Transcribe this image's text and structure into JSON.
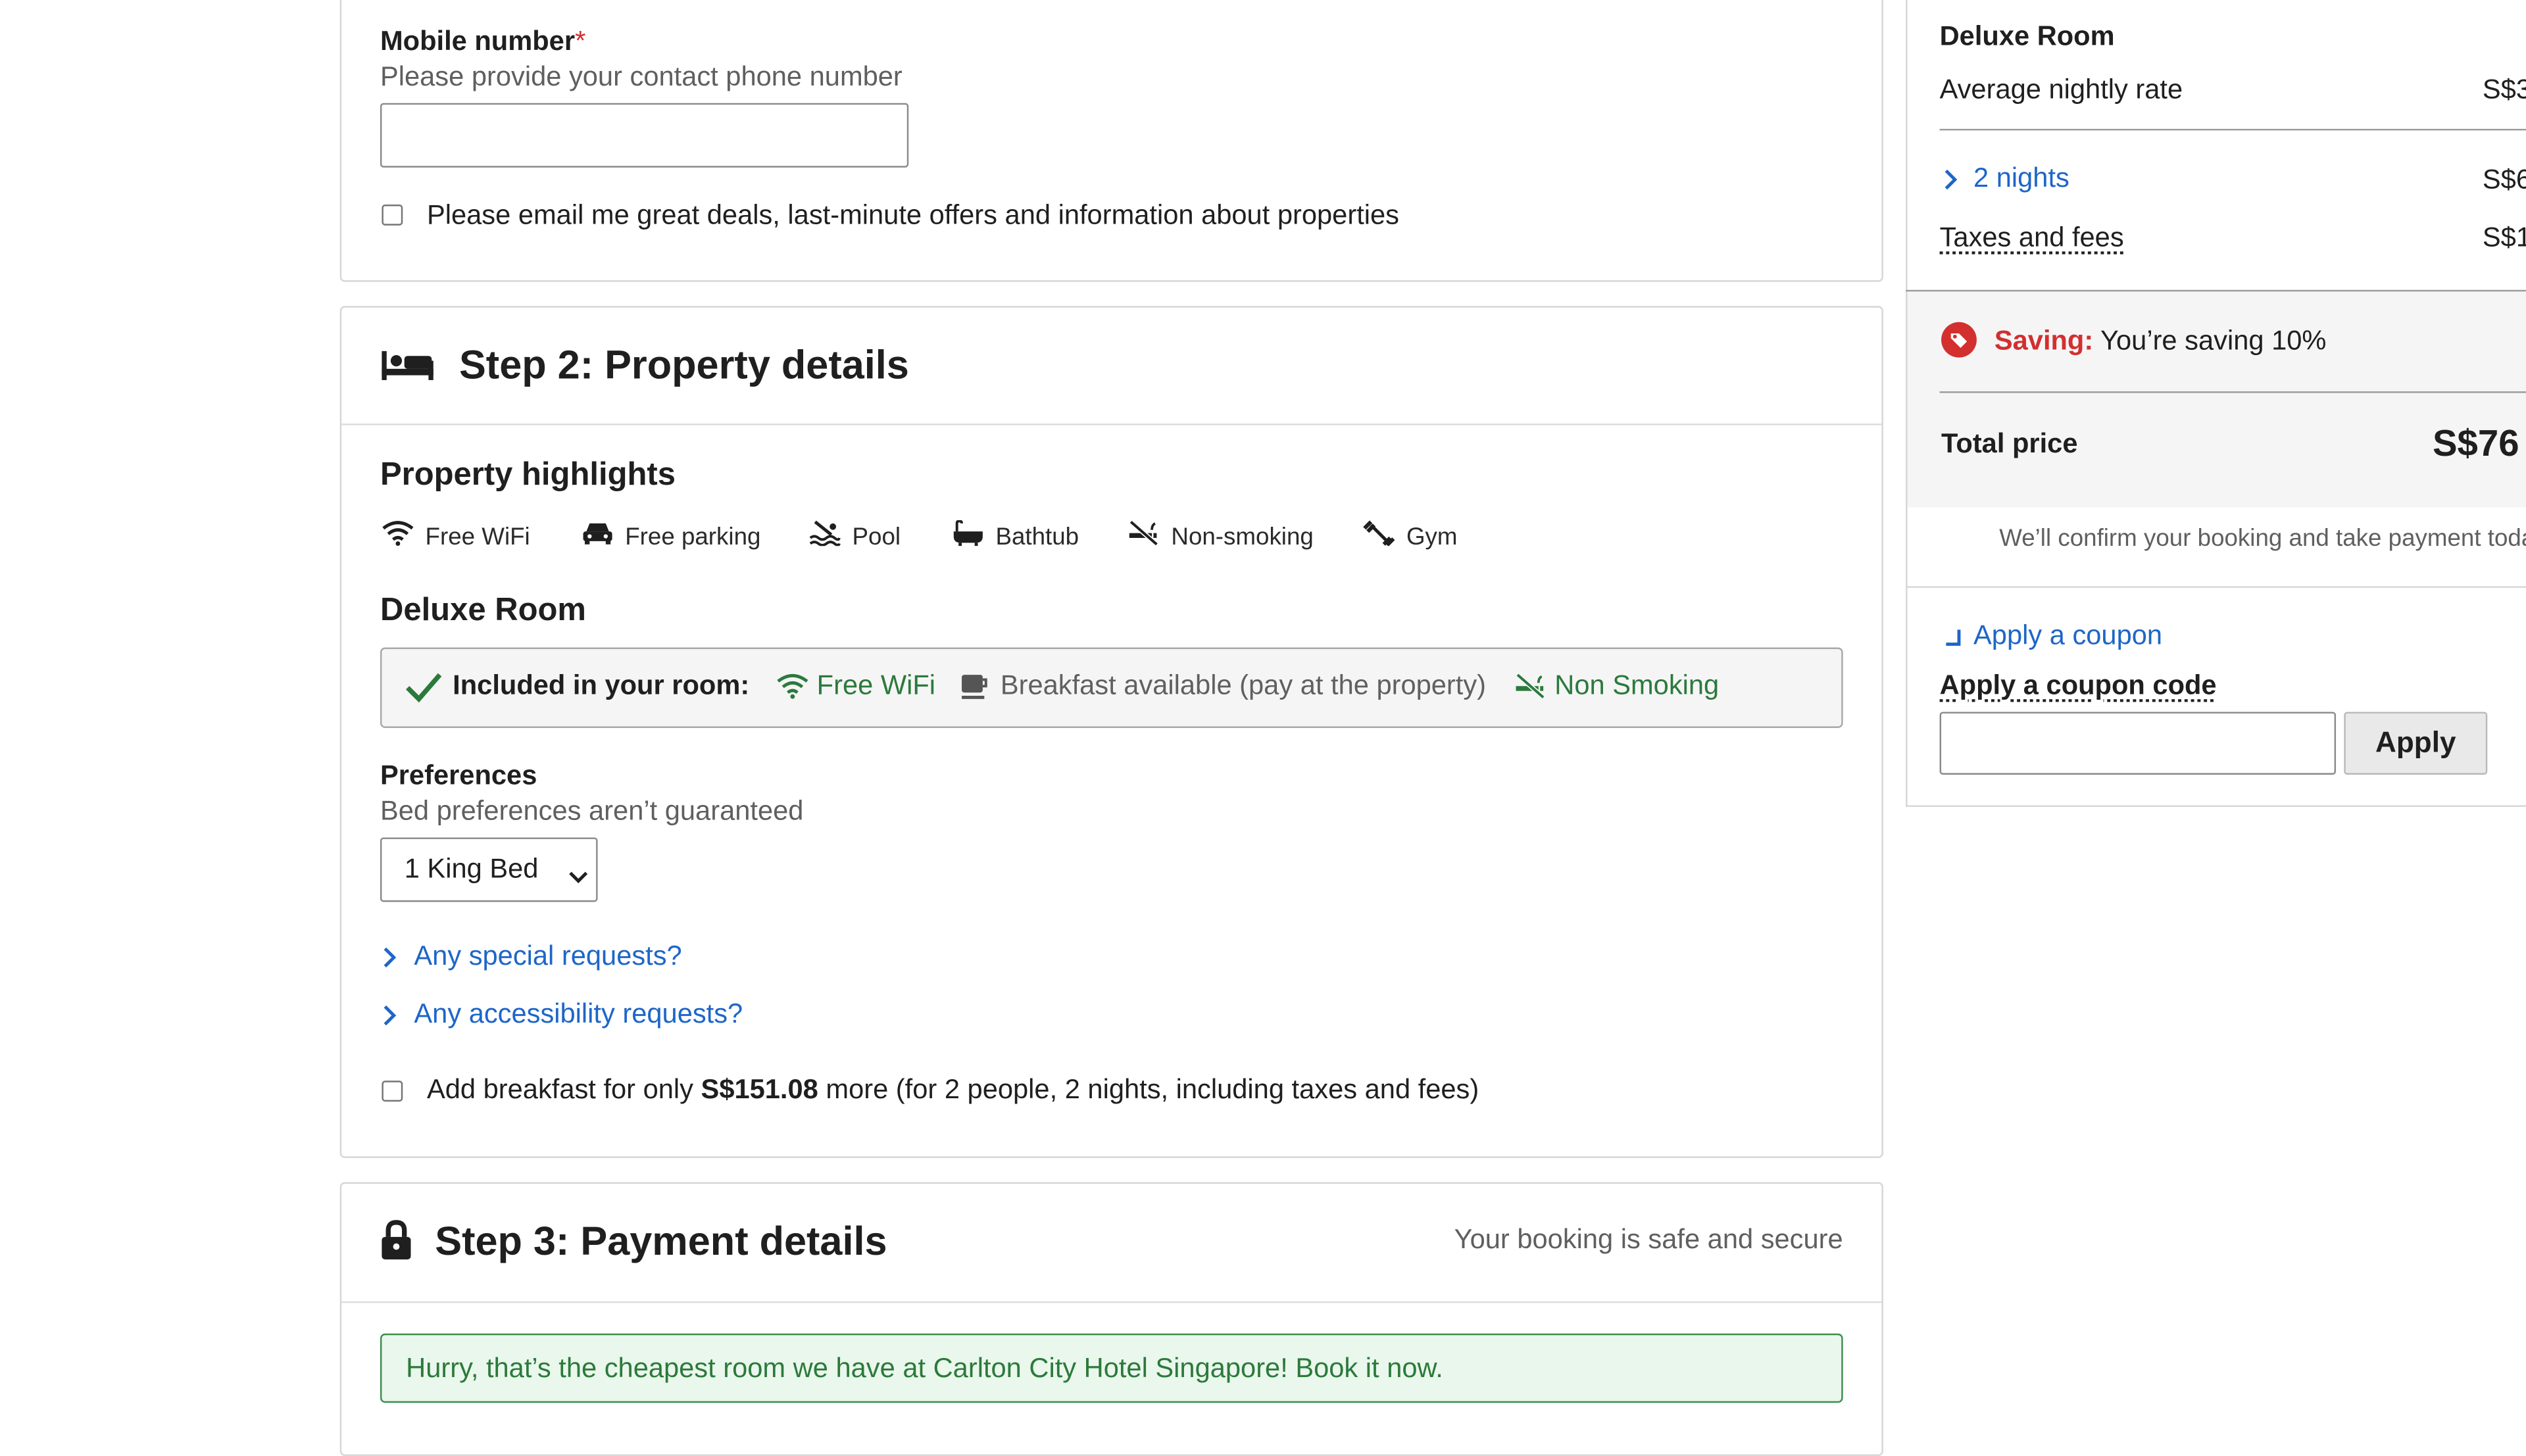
{
  "contact": {
    "mobile_label": "Mobile number",
    "required_mark": "*",
    "mobile_hint": "Please provide your contact phone number",
    "mobile_value": "",
    "email_opt_in_label": "Please email me great deals, last-minute offers and information about properties"
  },
  "step2": {
    "title": "Step 2: Property details",
    "highlights_heading": "Property highlights",
    "highlights": [
      {
        "icon": "wifi-icon",
        "label": "Free WiFi"
      },
      {
        "icon": "car-icon",
        "label": "Free parking"
      },
      {
        "icon": "pool-icon",
        "label": "Pool"
      },
      {
        "icon": "bathtub-icon",
        "label": "Bathtub"
      },
      {
        "icon": "no-smoking-icon",
        "label": "Non-smoking"
      },
      {
        "icon": "gym-icon",
        "label": "Gym"
      }
    ],
    "room_heading": "Deluxe Room",
    "included_label": "Included in your room:",
    "included": [
      {
        "icon": "wifi-icon",
        "label": "Free WiFi"
      },
      {
        "icon": "breakfast-icon",
        "label": "Breakfast available (pay at the property)"
      },
      {
        "icon": "no-smoking-icon",
        "label": "Non Smoking"
      }
    ],
    "preferences_label": "Preferences",
    "preferences_hint": "Bed preferences aren’t guaranteed",
    "bed_selected": "1 King Bed",
    "special_requests_link": "Any special requests?",
    "accessibility_requests_link": "Any accessibility requests?",
    "breakfast_prefix": "Add breakfast for only ",
    "breakfast_price": "S$151.08",
    "breakfast_suffix": " more (for 2 people, 2 nights, including taxes and fees)"
  },
  "step3": {
    "title": "Step 3: Payment details",
    "secure_note": "Your booking is safe and secure",
    "cheapest_banner": "Hurry, that’s the cheapest room we have at Carlton City Hotel Singapore! Book it now."
  },
  "summary": {
    "room_name": "Deluxe Room",
    "avg_rate_label": "Average nightly rate",
    "avg_rate_value": "S$3",
    "nights_link": "2 nights",
    "nights_value": "S$6",
    "taxes_label": "Taxes and fees",
    "taxes_value": "S$1",
    "saving_label": "Saving:",
    "saving_text": " You’re saving 10%",
    "total_label": "Total price",
    "total_value": "S$76",
    "confirm_note": "We’ll confirm your booking and take payment toda",
    "coupon_toggle": "Apply a coupon",
    "coupon_code_label": "Apply a coupon code",
    "coupon_value": "",
    "apply_button": "Apply"
  },
  "colors": {
    "link": "#1e66c8",
    "success_green": "#2b7a3b",
    "banner_bg": "#eaf7ec",
    "saving_red": "#d32f2f"
  }
}
